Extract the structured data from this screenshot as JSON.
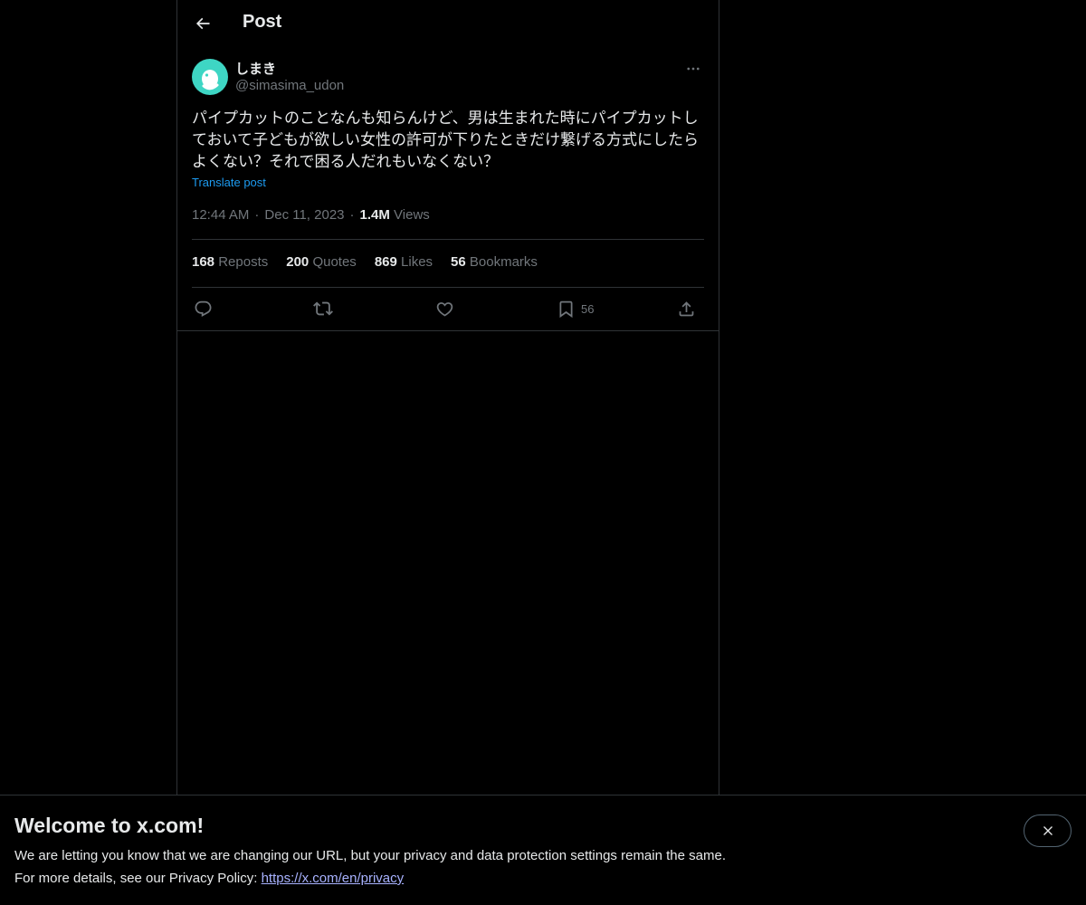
{
  "header": {
    "title": "Post"
  },
  "post": {
    "author_name": "しまき",
    "author_handle": "@simasima_udon",
    "text": "パイプカットのことなんも知らんけど、男は生まれた時にパイプカットしておいて子どもが欲しい女性の許可が下りたときだけ繋げる方式にしたらよくない？それで困る人だれもいなくない？",
    "translate_label": "Translate post",
    "time": "12:44 AM",
    "date": "Dec 11, 2023",
    "views_count": "1.4M",
    "views_label": "Views"
  },
  "stats": {
    "reposts_count": "168",
    "reposts_label": "Reposts",
    "quotes_count": "200",
    "quotes_label": "Quotes",
    "likes_count": "869",
    "likes_label": "Likes",
    "bookmarks_count": "56",
    "bookmarks_label": "Bookmarks"
  },
  "actions": {
    "bookmark_count": "56"
  },
  "icons": {
    "back": "arrow-left-icon",
    "more": "more-horizontal-icon",
    "reply": "reply-icon",
    "repost": "repost-icon",
    "like": "heart-icon",
    "bookmark": "bookmark-icon",
    "share": "share-icon",
    "close": "close-icon"
  },
  "colors": {
    "accent": "#1d9bf0",
    "muted": "#71767b",
    "text": "#e7e9ea",
    "border": "#2f3336",
    "avatar": "#3ed6c4"
  },
  "banner": {
    "title": "Welcome to x.com!",
    "line1": "We are letting you know that we are changing our URL, but your privacy and data protection settings remain the same.",
    "line2_prefix": "For more details, see our Privacy Policy: ",
    "link": "https://x.com/en/privacy"
  }
}
